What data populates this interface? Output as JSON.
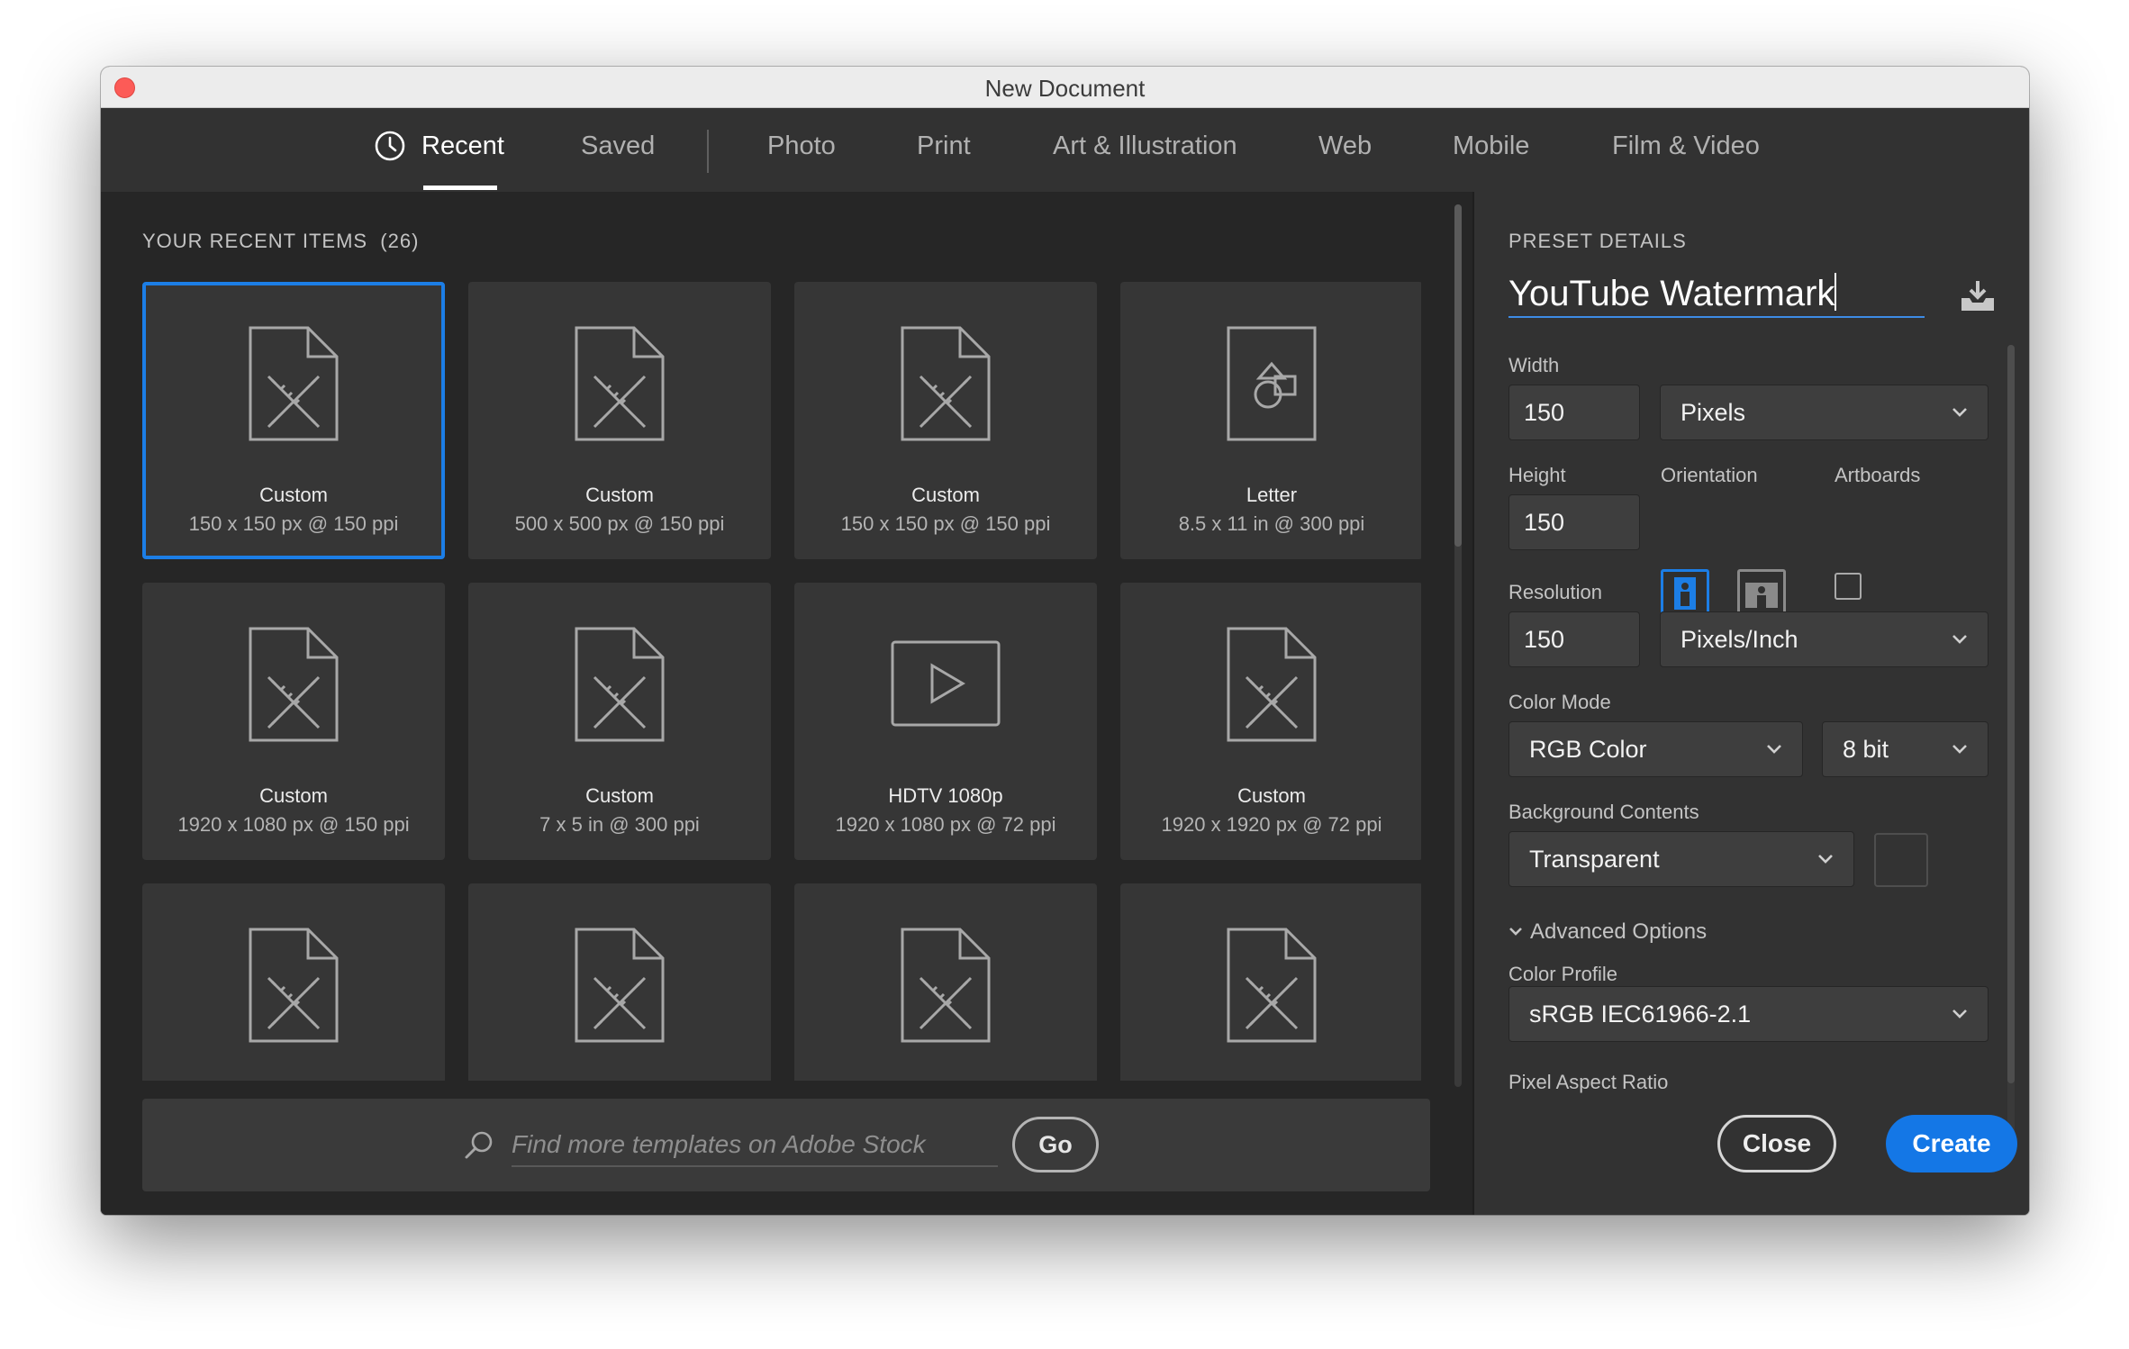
{
  "window": {
    "title": "New Document"
  },
  "tabs": [
    {
      "label": "Recent",
      "active": true,
      "icon": "clock-icon"
    },
    {
      "label": "Saved"
    },
    {
      "label": "Photo"
    },
    {
      "label": "Print"
    },
    {
      "label": "Art & Illustration"
    },
    {
      "label": "Web"
    },
    {
      "label": "Mobile"
    },
    {
      "label": "Film & Video"
    }
  ],
  "recent": {
    "header": "YOUR RECENT ITEMS",
    "count": "(26)",
    "items": [
      {
        "name": "Custom",
        "detail": "150 x 150 px @ 150 ppi",
        "icon": "custom-document-icon",
        "selected": true
      },
      {
        "name": "Custom",
        "detail": "500 x 500 px @ 150 ppi",
        "icon": "custom-document-icon"
      },
      {
        "name": "Custom",
        "detail": "150 x 150 px @ 150 ppi",
        "icon": "custom-document-icon"
      },
      {
        "name": "Letter",
        "detail": "8.5 x 11 in @ 300 ppi",
        "icon": "letter-document-icon"
      },
      {
        "name": "Custom",
        "detail": "1920 x 1080 px @ 150 ppi",
        "icon": "custom-document-icon"
      },
      {
        "name": "Custom",
        "detail": "7 x 5 in @ 300 ppi",
        "icon": "custom-document-icon"
      },
      {
        "name": "HDTV 1080p",
        "detail": "1920 x 1080 px @ 72 ppi",
        "icon": "video-play-icon"
      },
      {
        "name": "Custom",
        "detail": "1920 x 1920 px @ 72 ppi",
        "icon": "custom-document-icon"
      },
      {
        "name": "",
        "detail": "",
        "icon": "custom-document-icon"
      },
      {
        "name": "",
        "detail": "",
        "icon": "custom-document-icon"
      },
      {
        "name": "",
        "detail": "",
        "icon": "custom-document-icon"
      },
      {
        "name": "",
        "detail": "",
        "icon": "custom-document-icon"
      }
    ]
  },
  "search": {
    "placeholder": "Find more templates on Adobe Stock",
    "go_label": "Go"
  },
  "preset": {
    "header": "PRESET DETAILS",
    "name": "YouTube Watermark",
    "width_label": "Width",
    "width_value": "150",
    "width_unit": "Pixels",
    "height_label": "Height",
    "height_value": "150",
    "orientation_label": "Orientation",
    "artboards_label": "Artboards",
    "resolution_label": "Resolution",
    "resolution_value": "150",
    "resolution_unit": "Pixels/Inch",
    "color_mode_label": "Color Mode",
    "color_mode": "RGB Color",
    "bit_depth": "8 bit",
    "background_label": "Background Contents",
    "background_value": "Transparent",
    "advanced_label": "Advanced Options",
    "color_profile_label": "Color Profile",
    "color_profile": "sRGB IEC61966-2.1",
    "pixel_aspect_label": "Pixel Aspect Ratio"
  },
  "actions": {
    "close_label": "Close",
    "create_label": "Create"
  },
  "colors": {
    "accent": "#1477e6",
    "selection": "#1c7ee6",
    "close_dot": "#fc5b57"
  }
}
